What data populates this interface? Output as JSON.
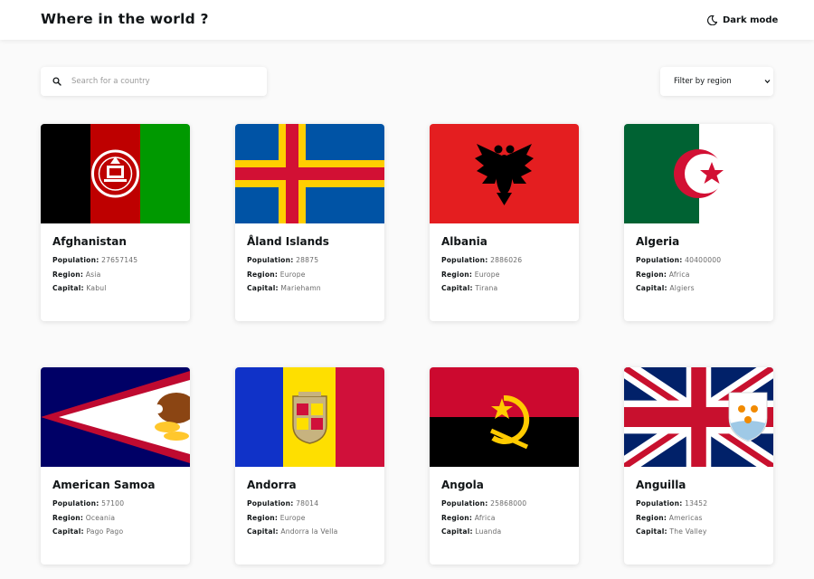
{
  "header": {
    "title": "Where in the world ?",
    "dark_mode_label": "Dark mode",
    "dark_mode_icon": "moon-icon"
  },
  "search": {
    "placeholder": "Search for a country",
    "value": "",
    "icon": "search-icon"
  },
  "filter": {
    "label": "Filter by region",
    "icon": "chevron-down-icon"
  },
  "labels": {
    "population": "Population:",
    "region": "Region:",
    "capital": "Capital:"
  },
  "countries": [
    {
      "name": "Afghanistan",
      "population": "27657145",
      "region": "Asia",
      "capital": "Kabul",
      "flag_icon": "afghanistan-flag"
    },
    {
      "name": "Åland Islands",
      "population": "28875",
      "region": "Europe",
      "capital": "Mariehamn",
      "flag_icon": "aland-islands-flag"
    },
    {
      "name": "Albania",
      "population": "2886026",
      "region": "Europe",
      "capital": "Tirana",
      "flag_icon": "albania-flag"
    },
    {
      "name": "Algeria",
      "population": "40400000",
      "region": "Africa",
      "capital": "Algiers",
      "flag_icon": "algeria-flag"
    },
    {
      "name": "American Samoa",
      "population": "57100",
      "region": "Oceania",
      "capital": "Pago Pago",
      "flag_icon": "american-samoa-flag"
    },
    {
      "name": "Andorra",
      "population": "78014",
      "region": "Europe",
      "capital": "Andorra la Vella",
      "flag_icon": "andorra-flag"
    },
    {
      "name": "Angola",
      "population": "25868000",
      "region": "Africa",
      "capital": "Luanda",
      "flag_icon": "angola-flag"
    },
    {
      "name": "Anguilla",
      "population": "13452",
      "region": "Americas",
      "capital": "The Valley",
      "flag_icon": "anguilla-flag"
    }
  ],
  "colors": {
    "background": "#fafafa",
    "surface": "#ffffff",
    "text": "#111517",
    "muted": "#6b6b6b"
  }
}
